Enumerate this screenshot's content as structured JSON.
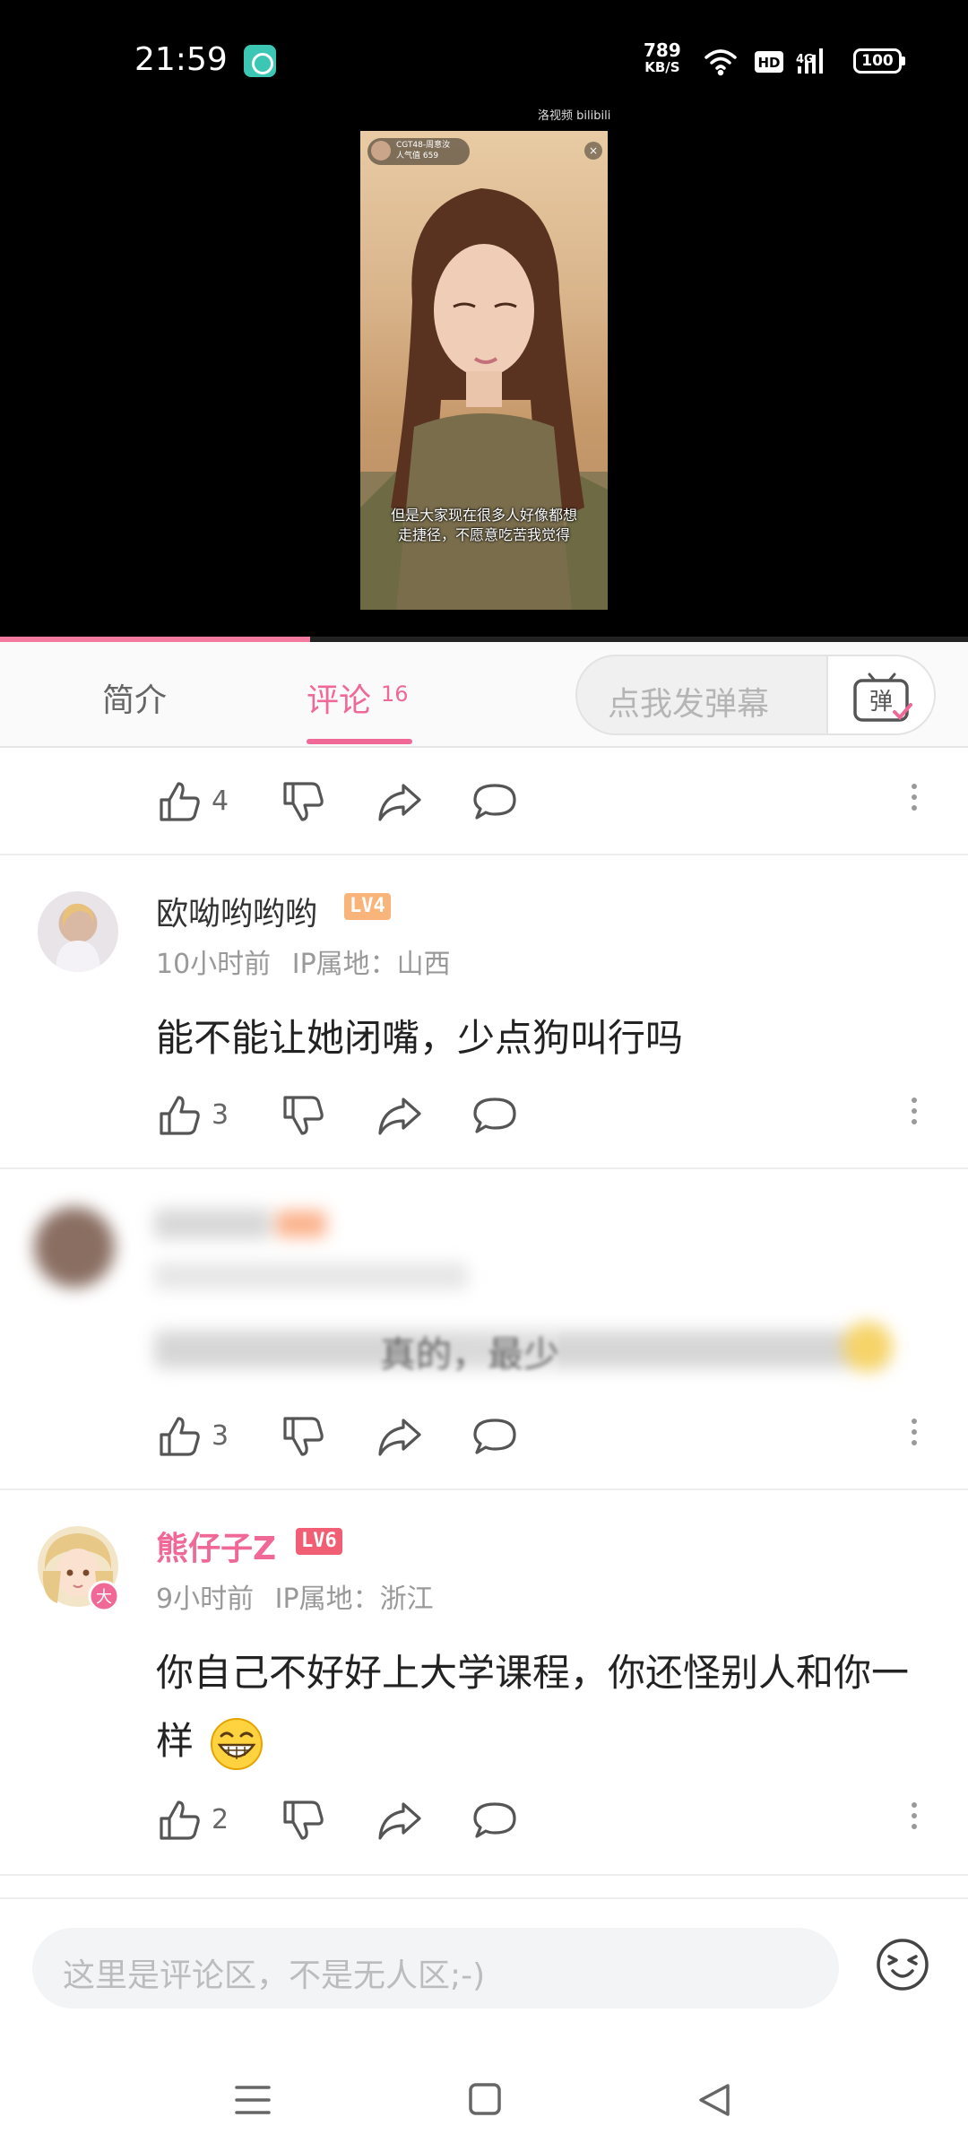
{
  "status_bar": {
    "time": "21:59",
    "speed_value": "789",
    "speed_unit": "KB/S",
    "battery": "100",
    "icons": [
      "chat-app-icon",
      "wifi-icon",
      "hd-icon",
      "4g-signal-icon",
      "battery-icon"
    ]
  },
  "video": {
    "watermark": "洛视频 bilibili",
    "live_name": "CGT48-周意汝",
    "live_popularity": "人气值 659",
    "subtitle": "但是大家现在很多人好像都想走捷径，不愿意吃苦我觉得",
    "progress": 0.32
  },
  "tabs": {
    "intro_label": "简介",
    "comments_label": "评论",
    "comments_count": "16",
    "danmaku_placeholder": "点我发弹幕",
    "danmaku_button_label": "弹"
  },
  "comments": [
    {
      "likes": "4"
    },
    {
      "username": "欧呦哟哟哟",
      "level": "LV4",
      "time": "10小时前",
      "ip": "IP属地：山西",
      "text": "能不能让她闭嘴，少点狗叫行吗",
      "likes": "3"
    },
    {
      "blurred": true,
      "visible_fragment": "真的，最少",
      "likes": "3"
    },
    {
      "username": "熊仔子Z",
      "level": "LV6",
      "badge": "大",
      "time": "9小时前",
      "ip": "IP属地：浙江",
      "text": "你自己不好好上大学课程，你还怪别人和你一样",
      "emoji": "grin-emoji",
      "likes": "2"
    }
  ],
  "input": {
    "placeholder": "这里是评论区，不是无人区;-)"
  },
  "colors": {
    "accent": "#f06996",
    "lv4": "#f9b47a",
    "lv6": "#f05f73",
    "vip_name": "#f06996"
  }
}
